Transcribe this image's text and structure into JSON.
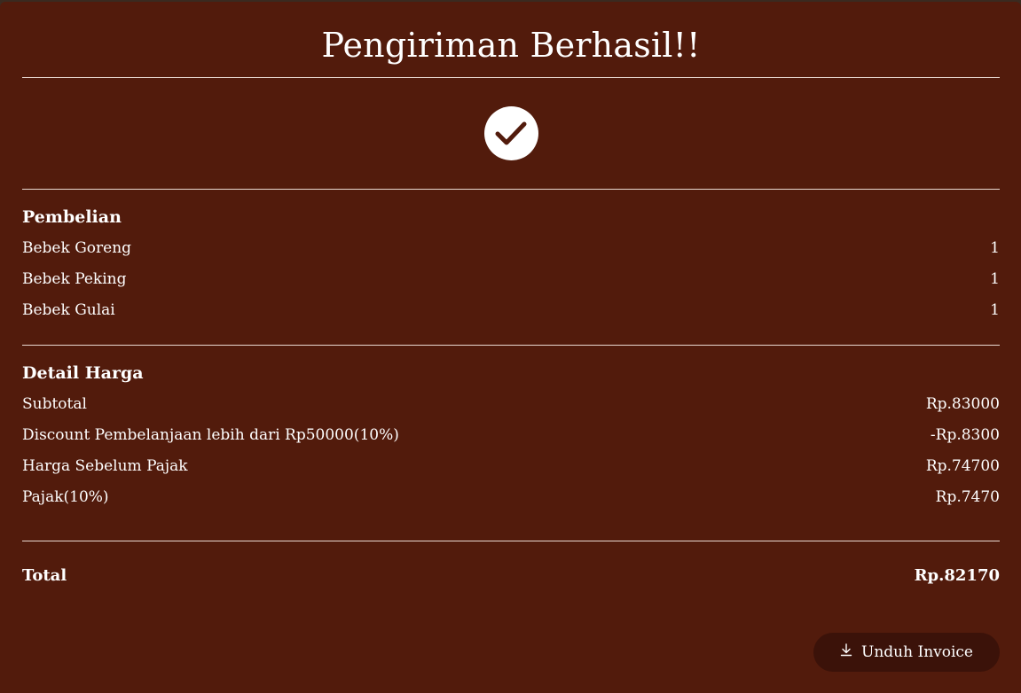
{
  "title": "Pengiriman Berhasil!!",
  "icons": {
    "success": "check-icon",
    "download": "download-icon"
  },
  "purchase": {
    "heading": "Pembelian",
    "items": [
      {
        "name": "Bebek Goreng",
        "qty": "1"
      },
      {
        "name": "Bebek Peking",
        "qty": "1"
      },
      {
        "name": "Bebek Gulai",
        "qty": "1"
      }
    ]
  },
  "price": {
    "heading": "Detail Harga",
    "rows": [
      {
        "label": "Subtotal",
        "value": "Rp.83000"
      },
      {
        "label": "Discount Pembelanjaan lebih dari Rp50000(10%)",
        "value": "-Rp.8300"
      },
      {
        "label": "Harga Sebelum Pajak",
        "value": "Rp.74700"
      },
      {
        "label": "Pajak(10%)",
        "value": "Rp.7470"
      }
    ]
  },
  "total": {
    "label": "Total",
    "value": "Rp.82170"
  },
  "download": {
    "label": "Unduh Invoice"
  },
  "colors": {
    "panel": "#521b0c",
    "button": "#3b1209",
    "text": "#ffffff"
  }
}
